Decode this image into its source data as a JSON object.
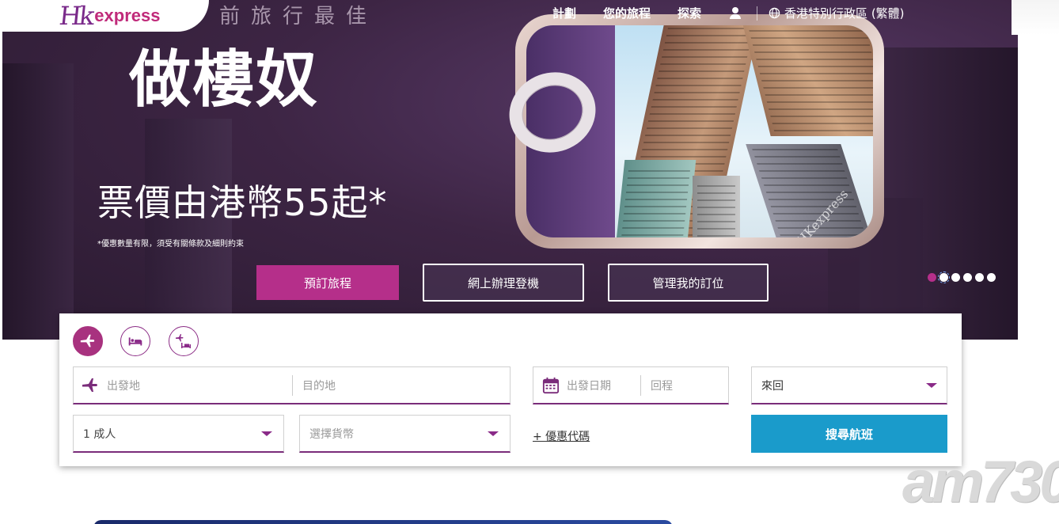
{
  "brand": {
    "logo_hk": "Hk",
    "logo_express": "express"
  },
  "hero": {
    "tagline": "前旅行最佳",
    "headline": "做樓奴",
    "price_text": "票價由港幣55起*",
    "fine_print": "*優惠數量有限，須受有關條款及細則約束",
    "can_mark": "HKexpress",
    "buttons": {
      "book": "預訂旅程",
      "checkin": "網上辦理登機",
      "manage": "管理我的訂位"
    },
    "carousel": {
      "count": 6,
      "active_index": 0
    }
  },
  "nav": {
    "items": [
      "計劃",
      "您的旅程",
      "探索"
    ],
    "language": "香港特別行政區 (繁體)",
    "icons": [
      "user-icon",
      "globe-icon"
    ]
  },
  "booking": {
    "tabs": [
      {
        "name": "flight",
        "icon": "plane-icon",
        "active": true
      },
      {
        "name": "hotel",
        "icon": "bed-icon",
        "active": false
      },
      {
        "name": "flight-hotel",
        "icon": "plane-bed-icon",
        "active": false
      }
    ],
    "origin_placeholder": "出發地",
    "destination_placeholder": "目的地",
    "depart_placeholder": "出發日期",
    "return_placeholder": "回程",
    "trip_type": "來回",
    "passengers": "1 成人",
    "currency_placeholder": "選擇貨幣",
    "promo_link": "+ 優惠代碼",
    "search_button": "搜尋航班"
  },
  "watermark": "am730",
  "colors": {
    "brand_purple": "#8a2a88",
    "magenta": "#b52f8a",
    "search_blue": "#1a9bcb"
  }
}
